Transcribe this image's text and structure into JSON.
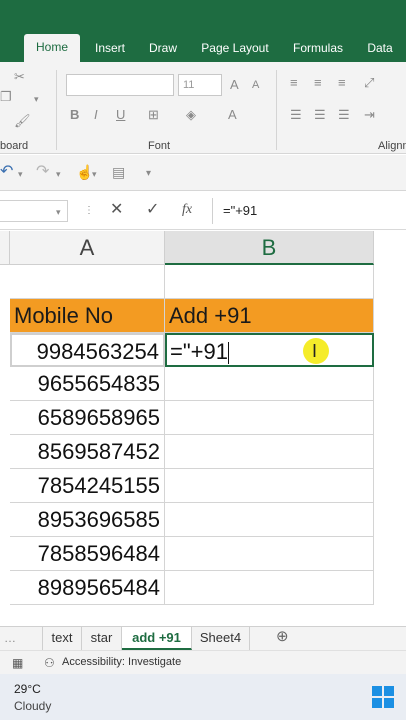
{
  "ribbon": {
    "tabs": [
      {
        "label": "Home",
        "active": true
      },
      {
        "label": "Insert",
        "active": false
      },
      {
        "label": "Draw",
        "active": false
      },
      {
        "label": "Page Layout",
        "active": false
      },
      {
        "label": "Formulas",
        "active": false
      },
      {
        "label": "Data",
        "active": false
      }
    ],
    "font_size_value": "11",
    "groups": {
      "clipboard": "board",
      "font": "Font",
      "alignment": "Alignm"
    }
  },
  "formula_bar": {
    "fx": "fx",
    "value": "=\"+91"
  },
  "sheet": {
    "columns": [
      "A",
      "B"
    ],
    "header_row": {
      "a": "Mobile No",
      "b": "Add +91"
    },
    "rows": [
      {
        "a": "9984563254",
        "b": "=\"+91"
      },
      {
        "a": "9655654835",
        "b": ""
      },
      {
        "a": "6589658965",
        "b": ""
      },
      {
        "a": "8569587452",
        "b": ""
      },
      {
        "a": "7854245155",
        "b": ""
      },
      {
        "a": "8953696585",
        "b": ""
      },
      {
        "a": "7858596484",
        "b": ""
      },
      {
        "a": "8989565484",
        "b": ""
      }
    ],
    "header_color": "#f39b22"
  },
  "sheet_tabs": [
    {
      "label": "text",
      "active": false
    },
    {
      "label": "star",
      "active": false
    },
    {
      "label": "add +91",
      "active": true
    },
    {
      "label": "Sheet4",
      "active": false
    }
  ],
  "status": {
    "accessibility": "Accessibility: Investigate"
  },
  "taskbar": {
    "temp": "29°C",
    "weather": "Cloudy"
  },
  "accent_color": "#1e6c41"
}
